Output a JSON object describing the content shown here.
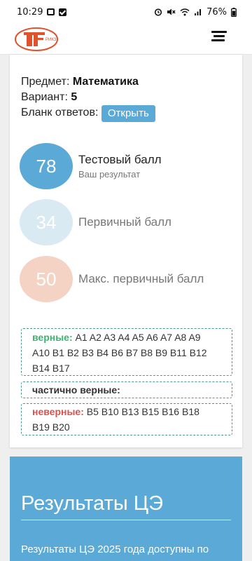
{
  "status_bar": {
    "time": "10:29",
    "battery": "76%",
    "icons": [
      "shopping-bag-icon",
      "check-box-icon",
      "alarm-icon",
      "mute-icon",
      "wifi-icon",
      "signal-icon"
    ]
  },
  "header": {
    "logo_text": "РИКЗ",
    "menu_icon": "hamburger-icon"
  },
  "info": {
    "subject_label": "Предмет:",
    "subject_value": "Математика",
    "variant_label": "Вариант:",
    "variant_value": "5",
    "answers_label": "Бланк ответов:",
    "open_button": "Открыть"
  },
  "scores": [
    {
      "value": "78",
      "label": "Тестовый балл",
      "sublabel": "Ваш результат",
      "color": "#5aa9d6"
    },
    {
      "value": "34",
      "label": "Первичный балл",
      "color": "#d9eaf2"
    },
    {
      "value": "50",
      "label": "Макс. первичный балл",
      "color": "#f5d3c4"
    }
  ],
  "answers": {
    "correct_label": "верные:",
    "correct_items": "A1 A2 A3 A4 A5 A6 A7 A8 A9",
    "correct_items_2": "A10 B1 B2 B3 B4 B6 B7 B8 B9 B11 B12",
    "correct_items_3": "B14 B17",
    "partial_label": "частично верные:",
    "wrong_label": "неверные:",
    "wrong_items": "B5 B10 B13 B15 B16 B18",
    "wrong_items_2": "B19 B20"
  },
  "ce_section": {
    "title": "Результаты ЦЭ",
    "text": "Результаты ЦЭ 2025 года доступны по"
  },
  "colors": {
    "accent": "#5aa9d6",
    "correct": "#3cb371",
    "wrong": "#d9534f"
  }
}
